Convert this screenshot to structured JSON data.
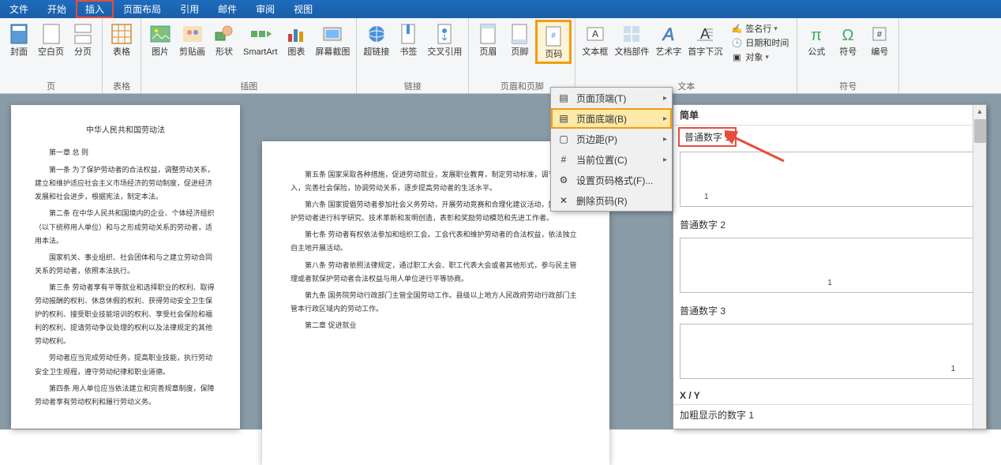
{
  "menubar": {
    "items": [
      "文件",
      "开始",
      "插入",
      "页面布局",
      "引用",
      "邮件",
      "审阅",
      "视图"
    ],
    "highlighted_index": 2
  },
  "ribbon": {
    "groups": [
      {
        "label": "页",
        "buttons": [
          {
            "label": "封面",
            "icon": "cover-page"
          },
          {
            "label": "空白页",
            "icon": "blank-page"
          },
          {
            "label": "分页",
            "icon": "page-break"
          }
        ]
      },
      {
        "label": "表格",
        "buttons": [
          {
            "label": "表格",
            "icon": "table"
          }
        ]
      },
      {
        "label": "插图",
        "buttons": [
          {
            "label": "图片",
            "icon": "picture"
          },
          {
            "label": "剪贴画",
            "icon": "clipart"
          },
          {
            "label": "形状",
            "icon": "shapes"
          },
          {
            "label": "SmartArt",
            "icon": "smartart"
          },
          {
            "label": "图表",
            "icon": "chart"
          },
          {
            "label": "屏幕截图",
            "icon": "screenshot"
          }
        ]
      },
      {
        "label": "链接",
        "buttons": [
          {
            "label": "超链接",
            "icon": "hyperlink"
          },
          {
            "label": "书签",
            "icon": "bookmark"
          },
          {
            "label": "交叉引用",
            "icon": "crossref"
          }
        ]
      },
      {
        "label": "页眉和页脚",
        "buttons": [
          {
            "label": "页眉",
            "icon": "header"
          },
          {
            "label": "页脚",
            "icon": "footer"
          },
          {
            "label": "页码",
            "icon": "page-number",
            "highlighted": true
          }
        ]
      },
      {
        "label": "文本",
        "buttons": [
          {
            "label": "文本框",
            "icon": "textbox"
          },
          {
            "label": "文档部件",
            "icon": "quickparts"
          },
          {
            "label": "艺术字",
            "icon": "wordart"
          },
          {
            "label": "首字下沉",
            "icon": "dropcap"
          }
        ],
        "small_buttons": [
          {
            "label": "签名行",
            "icon": "signature"
          },
          {
            "label": "日期和时间",
            "icon": "datetime"
          },
          {
            "label": "对象",
            "icon": "object"
          }
        ]
      },
      {
        "label": "符号",
        "buttons": [
          {
            "label": "公式",
            "icon": "equation"
          },
          {
            "label": "符号",
            "icon": "symbol"
          },
          {
            "label": "编号",
            "icon": "number"
          }
        ]
      }
    ]
  },
  "dropdown": {
    "items": [
      {
        "label": "页面顶端(T)",
        "icon": "top",
        "arrow": true
      },
      {
        "label": "页面底端(B)",
        "icon": "bottom",
        "arrow": true,
        "highlighted": true
      },
      {
        "label": "页边距(P)",
        "icon": "margin",
        "arrow": true
      },
      {
        "label": "当前位置(C)",
        "icon": "current",
        "arrow": true
      },
      {
        "label": "设置页码格式(F)...",
        "icon": "format"
      },
      {
        "label": "删除页码(R)",
        "icon": "remove"
      }
    ]
  },
  "gallery": {
    "header": "简单",
    "items": [
      {
        "label": "普通数字 1",
        "highlighted": true,
        "align": "left",
        "sample": "1"
      },
      {
        "label": "普通数字 2",
        "align": "center",
        "sample": "1"
      },
      {
        "label": "普通数字 3",
        "align": "right",
        "sample": "1"
      }
    ],
    "section2": "X / Y",
    "section2_item": "加粗显示的数字 1"
  },
  "document": {
    "page1": {
      "title": "中华人民共和国劳动法",
      "subtitle": "第一章 总 则",
      "paras": [
        "第一条 为了保护劳动者的合法权益，调整劳动关系，建立和维护适应社会主义市场经济的劳动制度，促进经济发展和社会进步，根据宪法，制定本法。",
        "第二条 在中华人民共和国境内的企业、个体经济组织（以下统称用人单位）和与之形成劳动关系的劳动者，适用本法。",
        "国家机关、事业组织、社会团体和与之建立劳动合同关系的劳动者，依照本法执行。",
        "第三条 劳动者享有平等就业和选择职业的权利、取得劳动报酬的权利、休息休假的权利、获得劳动安全卫生保护的权利、接受职业技能培训的权利、享受社会保险和福利的权利、提请劳动争议处理的权利以及法律规定的其他劳动权利。",
        "劳动者应当完成劳动任务，提高职业技能，执行劳动安全卫生规程，遵守劳动纪律和职业道德。",
        "第四条 用人单位应当依法建立和完善规章制度，保障劳动者享有劳动权利和履行劳动义务。"
      ]
    },
    "page2": {
      "paras": [
        "第五条 国家采取各种措施，促进劳动就业，发展职业教育，制定劳动标准，调节社会收入，完善社会保险，协调劳动关系，逐步提高劳动者的生活水平。",
        "第六条 国家提倡劳动者参加社会义务劳动，开展劳动竞赛和合理化建议活动，鼓励和保护劳动者进行科学研究、技术革新和发明创造，表彰和奖励劳动模范和先进工作者。",
        "第七条 劳动者有权依法参加和组织工会。工会代表和维护劳动者的合法权益，依法独立自主地开展活动。",
        "第八条 劳动者依照法律规定，通过职工大会、职工代表大会或者其他形式，参与民主管理或者就保护劳动者合法权益与用人单位进行平等协商。",
        "第九条 国务院劳动行政部门主管全国劳动工作。县级以上地方人民政府劳动行政部门主管本行政区域内的劳动工作。",
        "第二章 促进就业"
      ]
    }
  }
}
